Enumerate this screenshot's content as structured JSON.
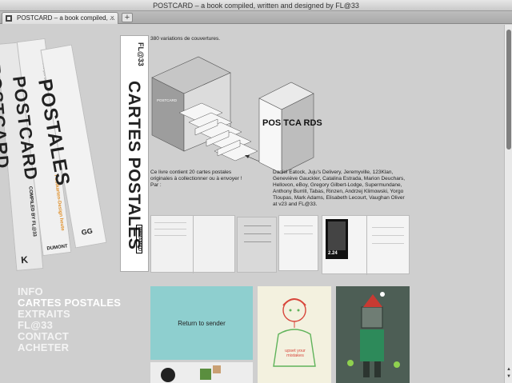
{
  "window": {
    "title": "POSTCARD – a book compiled, written and designed by FL@33"
  },
  "tab": {
    "label": "POSTCARD – a book compiled, ...",
    "close": "×",
    "new_tab": "+"
  },
  "spines": {
    "book1": {
      "title": "POSTCARD",
      "subtitle": "COMPILED BY FL@33",
      "publisher": "K"
    },
    "book2": {
      "title": "POSTCARD",
      "subtitle": "Postkarten-Design heute",
      "credit": "Diseño por correo",
      "publisher": "DUMONT"
    },
    "book3": {
      "title": "POSTALES",
      "publisher": "GG"
    },
    "main": {
      "title": "CARTES POSTALES",
      "author": "FL@33",
      "publisher": "PYRAMYD"
    }
  },
  "nav": {
    "items": [
      {
        "label": "INFO"
      },
      {
        "label": "CARTES POSTALES"
      },
      {
        "label": "EXTRAITS"
      },
      {
        "label": "FL@33"
      },
      {
        "label": "CONTACT"
      },
      {
        "label": "ACHETER"
      }
    ]
  },
  "content": {
    "variations": "380 variations de couvertures.",
    "description": "Ce livre contient 20 cartes postales originales à collectionner ou à envoyer ! Par :",
    "contributors": "Daniel Eatock, Juju's Delivery, Jeremyville, 123Klan, Geneviève Gauckler, Catalina Estrada, Marion Deuchars, Hellovon, eBoy, Gregory Gilbert-Lodge, Supermundane, Anthony Burrill, Tabas, Rinzen, Andrzej Klimowski, Yorgo Tloupas, Mark Adams, Elisabeth Lecourt, Vaughan Oliver at v23 and FL@33.",
    "illus_cover_text": "POS TCA RDS",
    "stamp_value": "2.24",
    "thumb1_label": "Return to sender",
    "thumb2_text": "upset your mistakes"
  },
  "colors": {
    "background": "#cfcfcf",
    "nav_text": "#ffffff",
    "teal_card": "#8ecfcf",
    "accent_orange": "#e0902a",
    "tshirt_green": "#5fb35a",
    "hair_red": "#d8473c"
  }
}
